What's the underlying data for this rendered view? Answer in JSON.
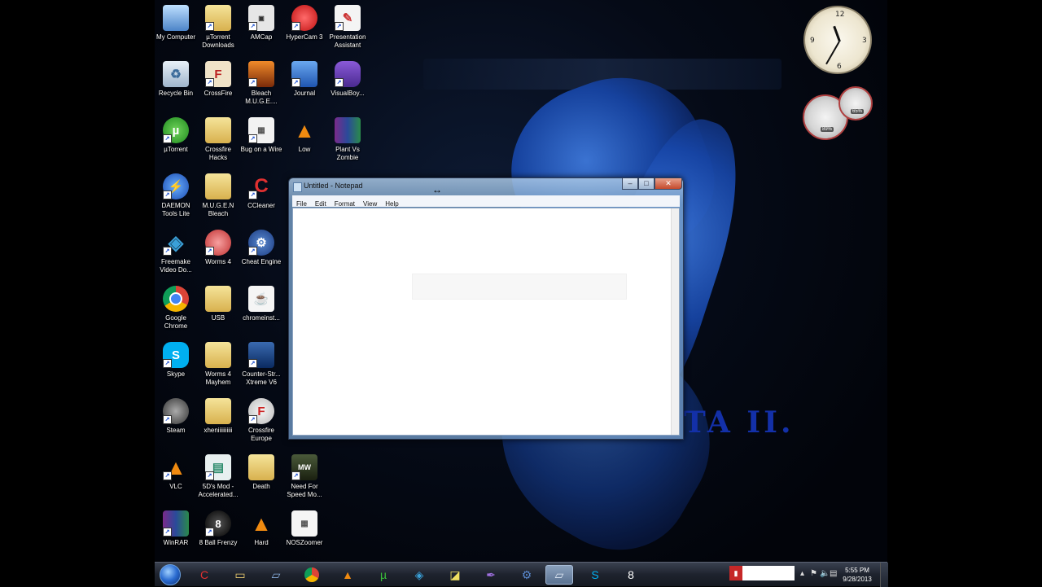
{
  "desktop": {
    "icons": [
      {
        "label": "My Computer"
      },
      {
        "label": "µTorrent Downloads"
      },
      {
        "label": "AMCap"
      },
      {
        "label": "HyperCam 3"
      },
      {
        "label": "Presentation Assistant"
      },
      {
        "label": "Recycle Bin"
      },
      {
        "label": "CrossFire"
      },
      {
        "label": "Bleach M.U.G.E...."
      },
      {
        "label": "Journal"
      },
      {
        "label": "VisualBoy..."
      },
      {
        "label": "µTorrent"
      },
      {
        "label": "Crossfire Hacks"
      },
      {
        "label": "Bug on a Wire"
      },
      {
        "label": "Low"
      },
      {
        "label": "Plant Vs Zombie"
      },
      {
        "label": "DAEMON Tools Lite"
      },
      {
        "label": "M.U.G.E.N Bleach"
      },
      {
        "label": "CCleaner"
      },
      {
        "label": "Freemake Video Do..."
      },
      {
        "label": "Worms 4"
      },
      {
        "label": "Cheat Engine"
      },
      {
        "label": "Google Chrome"
      },
      {
        "label": "USB"
      },
      {
        "label": "chromeinst..."
      },
      {
        "label": "Skype"
      },
      {
        "label": "Worms 4 Mayhem"
      },
      {
        "label": "Counter-Str... Xtreme V6"
      },
      {
        "label": "Steam"
      },
      {
        "label": "xheniiiiiiiiii"
      },
      {
        "label": "Crossfire Europe"
      },
      {
        "label": "VLC"
      },
      {
        "label": "5D's Mod - Accelerated..."
      },
      {
        "label": "Death"
      },
      {
        "label": "Need For Speed Mo..."
      },
      {
        "label": "WinRAR"
      },
      {
        "label": "8 Ball Frenzy"
      },
      {
        "label": "Hard"
      },
      {
        "label": "NOSZoomer"
      }
    ],
    "wallpaper_text": "TA II."
  },
  "gadgets": {
    "meter_cpu": "89%",
    "meter_mem": "65%"
  },
  "notepad": {
    "title": "Untitled - Notepad",
    "menu": [
      "File",
      "Edit",
      "Format",
      "View",
      "Help"
    ],
    "content": ""
  },
  "taskbar": {
    "pinned": [
      "CCleaner",
      "Windows Explorer",
      "Window Switcher",
      "Google Chrome",
      "VLC",
      "µTorrent",
      "Freemake",
      "Sticky Notes",
      "Feather",
      "Cheat Engine",
      "Notepad",
      "Skype",
      "8 Ball Frenzy"
    ]
  },
  "tray": {
    "time": "5:55 PM",
    "date": "9/28/2013"
  }
}
